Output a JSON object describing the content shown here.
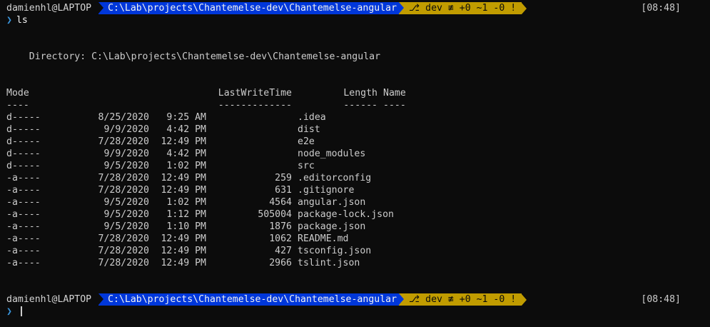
{
  "prompt1": {
    "user": "damienhl@LAPTOP",
    "path": "C:\\Lab\\projects\\Chantemelse-dev\\Chantemelse-angular",
    "git": "⎇ dev ≢ +0 ~1 -0 !",
    "time": "[08:48]"
  },
  "command": {
    "chevron": "❯",
    "text": "ls"
  },
  "directory": "    Directory: C:\\Lab\\projects\\Chantemelse-dev\\Chantemelse-angular",
  "headers": {
    "mode": "Mode",
    "lastwrite": "LastWriteTime",
    "length": "Length",
    "name": "Name",
    "mode_ul": "----",
    "lastwrite_ul": "-------------",
    "length_ul": "------",
    "name_ul": "----"
  },
  "rows": [
    {
      "mode": "d-----",
      "date": "8/25/2020",
      "time": "9:25 AM",
      "length": "",
      "name": ".idea"
    },
    {
      "mode": "d-----",
      "date": "9/9/2020",
      "time": "4:42 PM",
      "length": "",
      "name": "dist"
    },
    {
      "mode": "d-----",
      "date": "7/28/2020",
      "time": "12:49 PM",
      "length": "",
      "name": "e2e"
    },
    {
      "mode": "d-----",
      "date": "9/9/2020",
      "time": "4:42 PM",
      "length": "",
      "name": "node_modules"
    },
    {
      "mode": "d-----",
      "date": "9/5/2020",
      "time": "1:02 PM",
      "length": "",
      "name": "src"
    },
    {
      "mode": "-a----",
      "date": "7/28/2020",
      "time": "12:49 PM",
      "length": "259",
      "name": ".editorconfig"
    },
    {
      "mode": "-a----",
      "date": "7/28/2020",
      "time": "12:49 PM",
      "length": "631",
      "name": ".gitignore"
    },
    {
      "mode": "-a----",
      "date": "9/5/2020",
      "time": "1:02 PM",
      "length": "4564",
      "name": "angular.json"
    },
    {
      "mode": "-a----",
      "date": "9/5/2020",
      "time": "1:12 PM",
      "length": "505004",
      "name": "package-lock.json"
    },
    {
      "mode": "-a----",
      "date": "9/5/2020",
      "time": "1:10 PM",
      "length": "1876",
      "name": "package.json"
    },
    {
      "mode": "-a----",
      "date": "7/28/2020",
      "time": "12:49 PM",
      "length": "1062",
      "name": "README.md"
    },
    {
      "mode": "-a----",
      "date": "7/28/2020",
      "time": "12:49 PM",
      "length": "427",
      "name": "tsconfig.json"
    },
    {
      "mode": "-a----",
      "date": "7/28/2020",
      "time": "12:49 PM",
      "length": "2966",
      "name": "tslint.json"
    }
  ],
  "prompt2": {
    "user": "damienhl@LAPTOP",
    "path": "C:\\Lab\\projects\\Chantemelse-dev\\Chantemelse-angular",
    "git": "⎇ dev ≢ +0 ~1 -0 !",
    "time": "[08:48]",
    "chevron": "❯"
  },
  "colors": {
    "background": "#0c0c0c",
    "path_segment": "#0037da",
    "git_segment": "#c19c00",
    "chevron": "#3a96dd"
  }
}
